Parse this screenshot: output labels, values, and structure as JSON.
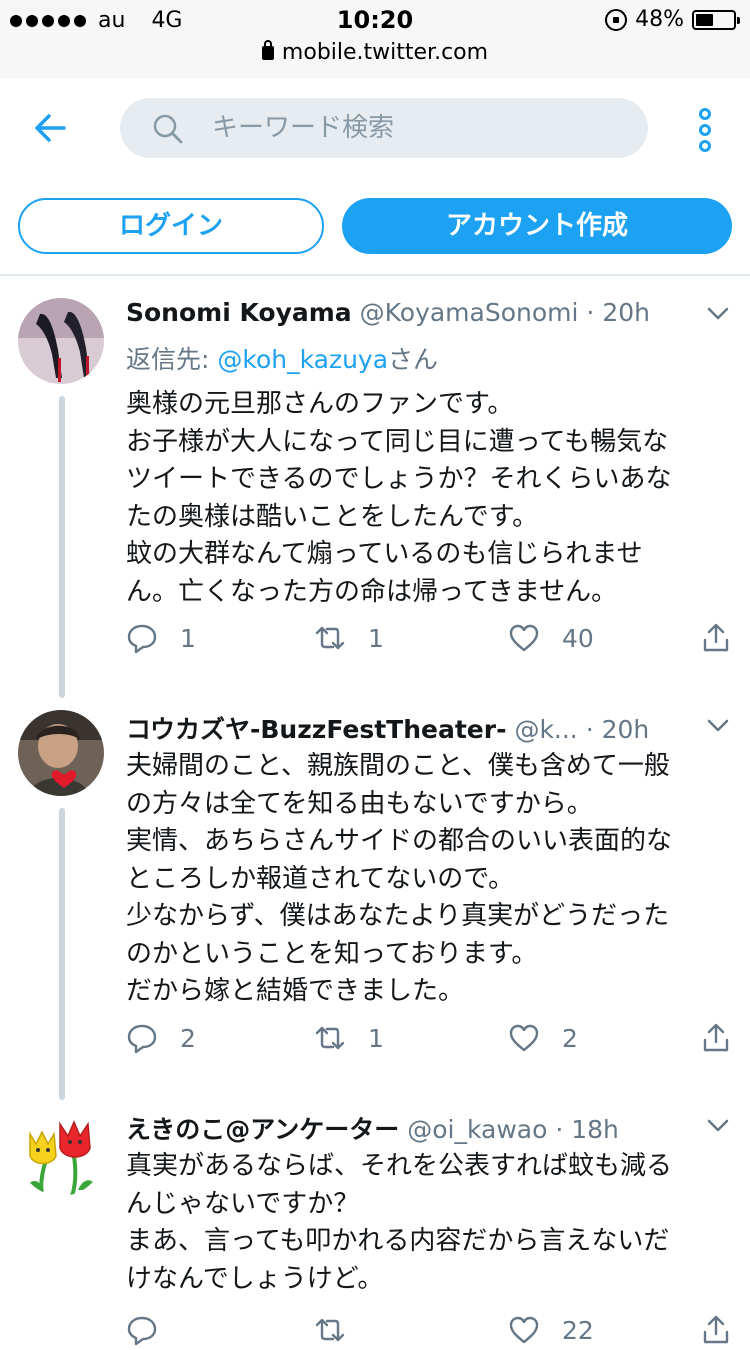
{
  "status_bar": {
    "carrier": "au",
    "network": "4G",
    "time": "10:20",
    "battery": "48%",
    "battery_level": 0.48,
    "url": "mobile.twitter.com"
  },
  "top_bar": {
    "search_placeholder": "キーワード検索"
  },
  "auth": {
    "login_label": "ログイン",
    "signup_label": "アカウント作成"
  },
  "colors": {
    "accent": "#1da1f2",
    "secondary_text": "#657786",
    "search_bg": "#e6ecf0",
    "thread_line": "#ccd6dd"
  },
  "tweets": [
    {
      "name": "Sonomi Koyama",
      "handle": "@KoyamaSonomi",
      "separator": "·",
      "time": "20h",
      "reply_prefix": "返信先: ",
      "reply_handle": "@koh_kazuya",
      "reply_suffix": "さん",
      "lines": [
        "奥様の元旦那さんのファンです。",
        "お子様が大人になって同じ目に遭っても暢気な",
        "ツイートできるのでしょうか？それくらいあな",
        "たの奥様は酷いことをしたんです。",
        "蚊の大群なんて煽っているのも信じられませ",
        "ん。亡くなった方の命は帰ってきません。"
      ],
      "replies": "1",
      "retweets": "1",
      "likes": "40",
      "avatar_icon": "high-heels-photo"
    },
    {
      "name": "コウカズヤ-BuzzFestTheater-",
      "handle": "@k...",
      "separator": "·",
      "time": "20h",
      "lines": [
        "夫婦間のこと、親族間のこと、僕も含めて一般",
        "の方々は全てを知る由もないですから。",
        "実情、あちらさんサイドの都合のいい表面的な",
        "ところしか報道されてないので。",
        "少なからず、僕はあなたより真実がどうだった",
        "のかということを知っております。",
        "だから嫁と結婚できました。"
      ],
      "replies": "2",
      "retweets": "1",
      "likes": "2",
      "avatar_icon": "person-with-heart-photo"
    },
    {
      "name": "えきのこ@アンケーター",
      "handle": "@oi_kawao",
      "separator": "·",
      "time": "18h",
      "lines": [
        "真実があるならば、それを公表すれば蚊も減る",
        "んじゃないですか？",
        "まあ、言っても叩かれる内容だから言えないだ",
        "けなんでしょうけど。"
      ],
      "replies": "",
      "retweets": "",
      "likes": "22",
      "avatar_icon": "tulips-illustration"
    }
  ]
}
